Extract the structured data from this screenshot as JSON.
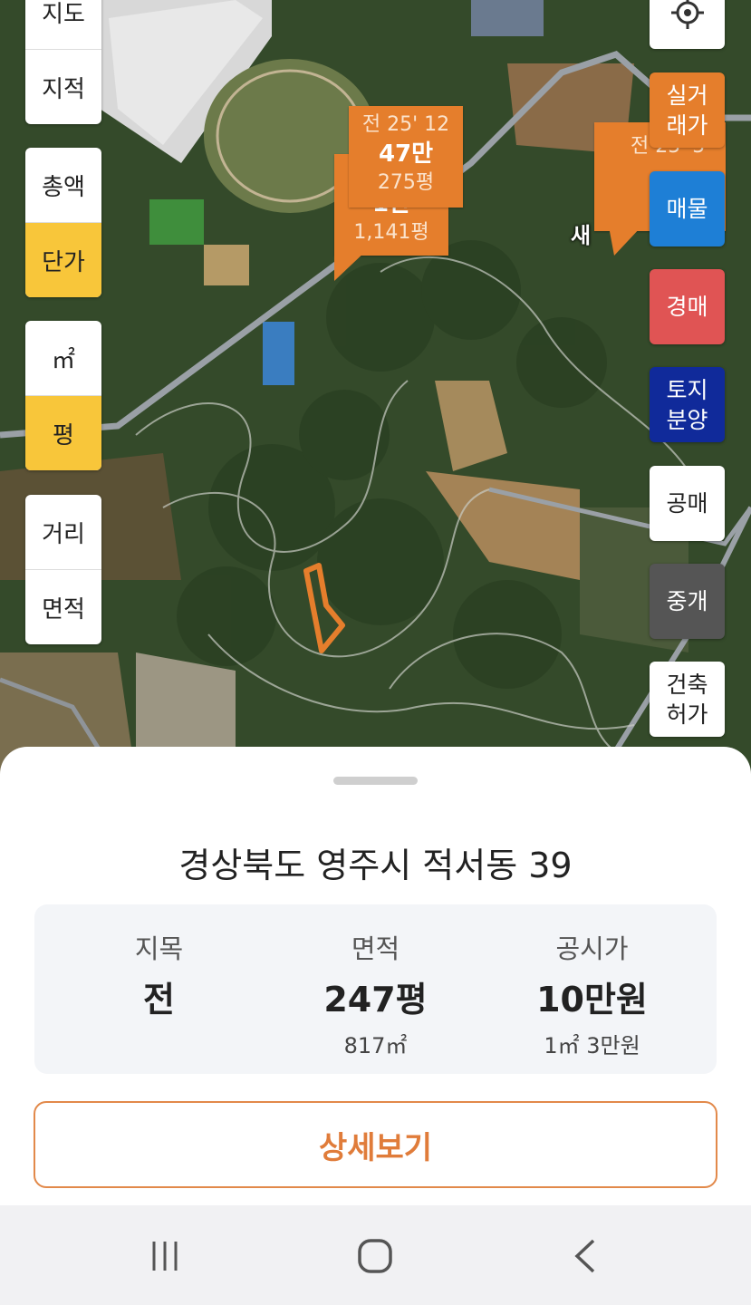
{
  "map": {
    "left_controls": {
      "view": [
        "지도",
        "지적"
      ],
      "price_mode": [
        "총액",
        "단가"
      ],
      "unit": [
        "㎡",
        "평"
      ],
      "measure": [
        "거리",
        "면적"
      ]
    },
    "right_controls": {
      "locate_icon": "crosshair-icon",
      "trade": "실거\n래가",
      "listing": "매물",
      "auction": "경매",
      "land_sale": "토지\n분양",
      "public_sale": "공매",
      "broker": "중개",
      "permit": "건축\n허가"
    },
    "markers": {
      "m1": {
        "line1": "전 25' 12",
        "line2": "47만",
        "line3": "275평"
      },
      "m1_back": {
        "line2": "1만",
        "line3": "1,141평"
      },
      "m2": {
        "line1": "전 25' 5"
      }
    },
    "place_label": "새"
  },
  "sheet": {
    "address": "경상북도 영주시 적서동 39",
    "land_type_label": "지목",
    "land_type_value": "전",
    "area_label": "면적",
    "area_value": "247평",
    "area_sub": "817㎡",
    "price_label": "공시가",
    "price_value": "10만원",
    "price_sub": "1㎡ 3만원",
    "detail_button": "상세보기"
  },
  "colors": {
    "accent_orange": "#e57e2c",
    "active_yellow": "#f8c63a",
    "listing_blue": "#1e7fd6",
    "auction_red": "#e05454",
    "land_sale_navy": "#102a9a",
    "broker_gray": "#555555"
  },
  "nav": {
    "recent_icon": "recent-apps-icon",
    "home_icon": "home-icon",
    "back_icon": "back-icon"
  }
}
